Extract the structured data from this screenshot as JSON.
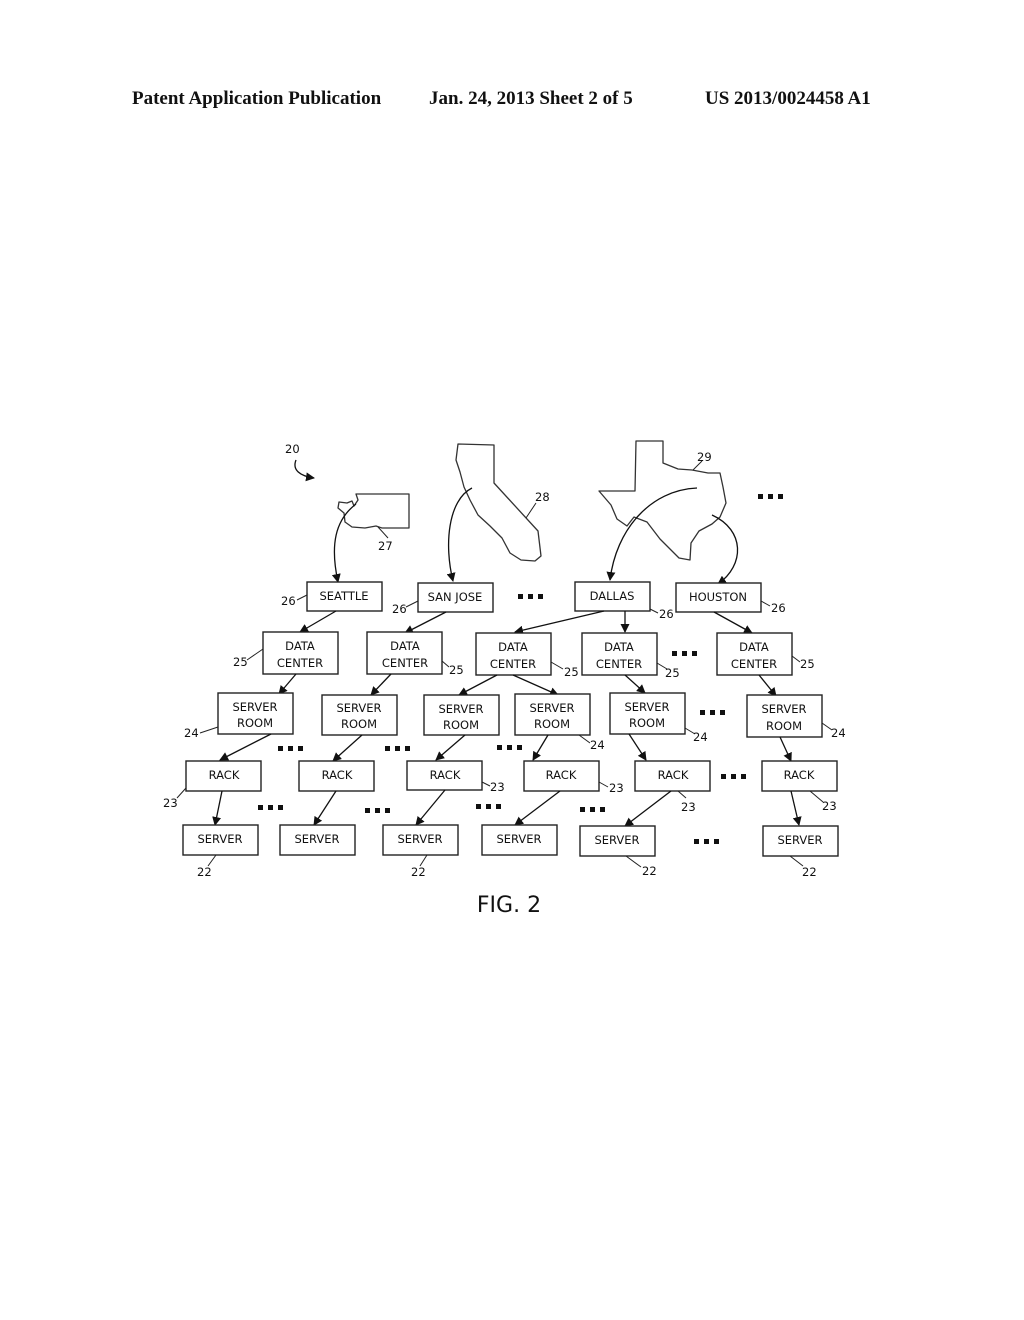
{
  "header": {
    "left": "Patent Application Publication",
    "middle": "Jan. 24, 2013  Sheet 2 of 5",
    "right": "US 2013/0024458 A1"
  },
  "figure": {
    "label": "FIG. 2",
    "system_ref": "20",
    "states": [
      {
        "name": "washington-state",
        "ref": "27"
      },
      {
        "name": "california-state",
        "ref": "28"
      },
      {
        "name": "texas-state",
        "ref": "29"
      }
    ],
    "cities": [
      {
        "label": "SEATTLE",
        "ref": "26"
      },
      {
        "label": "SAN JOSE",
        "ref": "26"
      },
      {
        "label": "DALLAS",
        "ref": "26"
      },
      {
        "label": "HOUSTON",
        "ref": "26"
      }
    ],
    "data_centers": [
      {
        "line1": "DATA",
        "line2": "CENTER",
        "ref": "25"
      },
      {
        "line1": "DATA",
        "line2": "CENTER",
        "ref": "25"
      },
      {
        "line1": "DATA",
        "line2": "CENTER",
        "ref": "25"
      },
      {
        "line1": "DATA",
        "line2": "CENTER",
        "ref": "25"
      },
      {
        "line1": "DATA",
        "line2": "CENTER",
        "ref": "25"
      }
    ],
    "server_rooms": [
      {
        "line1": "SERVER",
        "line2": "ROOM",
        "ref": "24"
      },
      {
        "line1": "SERVER",
        "line2": "ROOM",
        "ref": ""
      },
      {
        "line1": "SERVER",
        "line2": "ROOM",
        "ref": ""
      },
      {
        "line1": "SERVER",
        "line2": "ROOM",
        "ref": "24"
      },
      {
        "line1": "SERVER",
        "line2": "ROOM",
        "ref": "24"
      },
      {
        "line1": "SERVER",
        "line2": "ROOM",
        "ref": "24"
      }
    ],
    "racks": [
      {
        "label": "RACK",
        "ref": "23"
      },
      {
        "label": "RACK",
        "ref": ""
      },
      {
        "label": "RACK",
        "ref": "23"
      },
      {
        "label": "RACK",
        "ref": "23"
      },
      {
        "label": "RACK",
        "ref": "23"
      },
      {
        "label": "RACK",
        "ref": "23"
      }
    ],
    "servers": [
      {
        "label": "SERVER",
        "ref": "22"
      },
      {
        "label": "SERVER",
        "ref": ""
      },
      {
        "label": "SERVER",
        "ref": "22"
      },
      {
        "label": "SERVER",
        "ref": ""
      },
      {
        "label": "SERVER",
        "ref": "22"
      },
      {
        "label": "SERVER",
        "ref": "22"
      }
    ]
  }
}
